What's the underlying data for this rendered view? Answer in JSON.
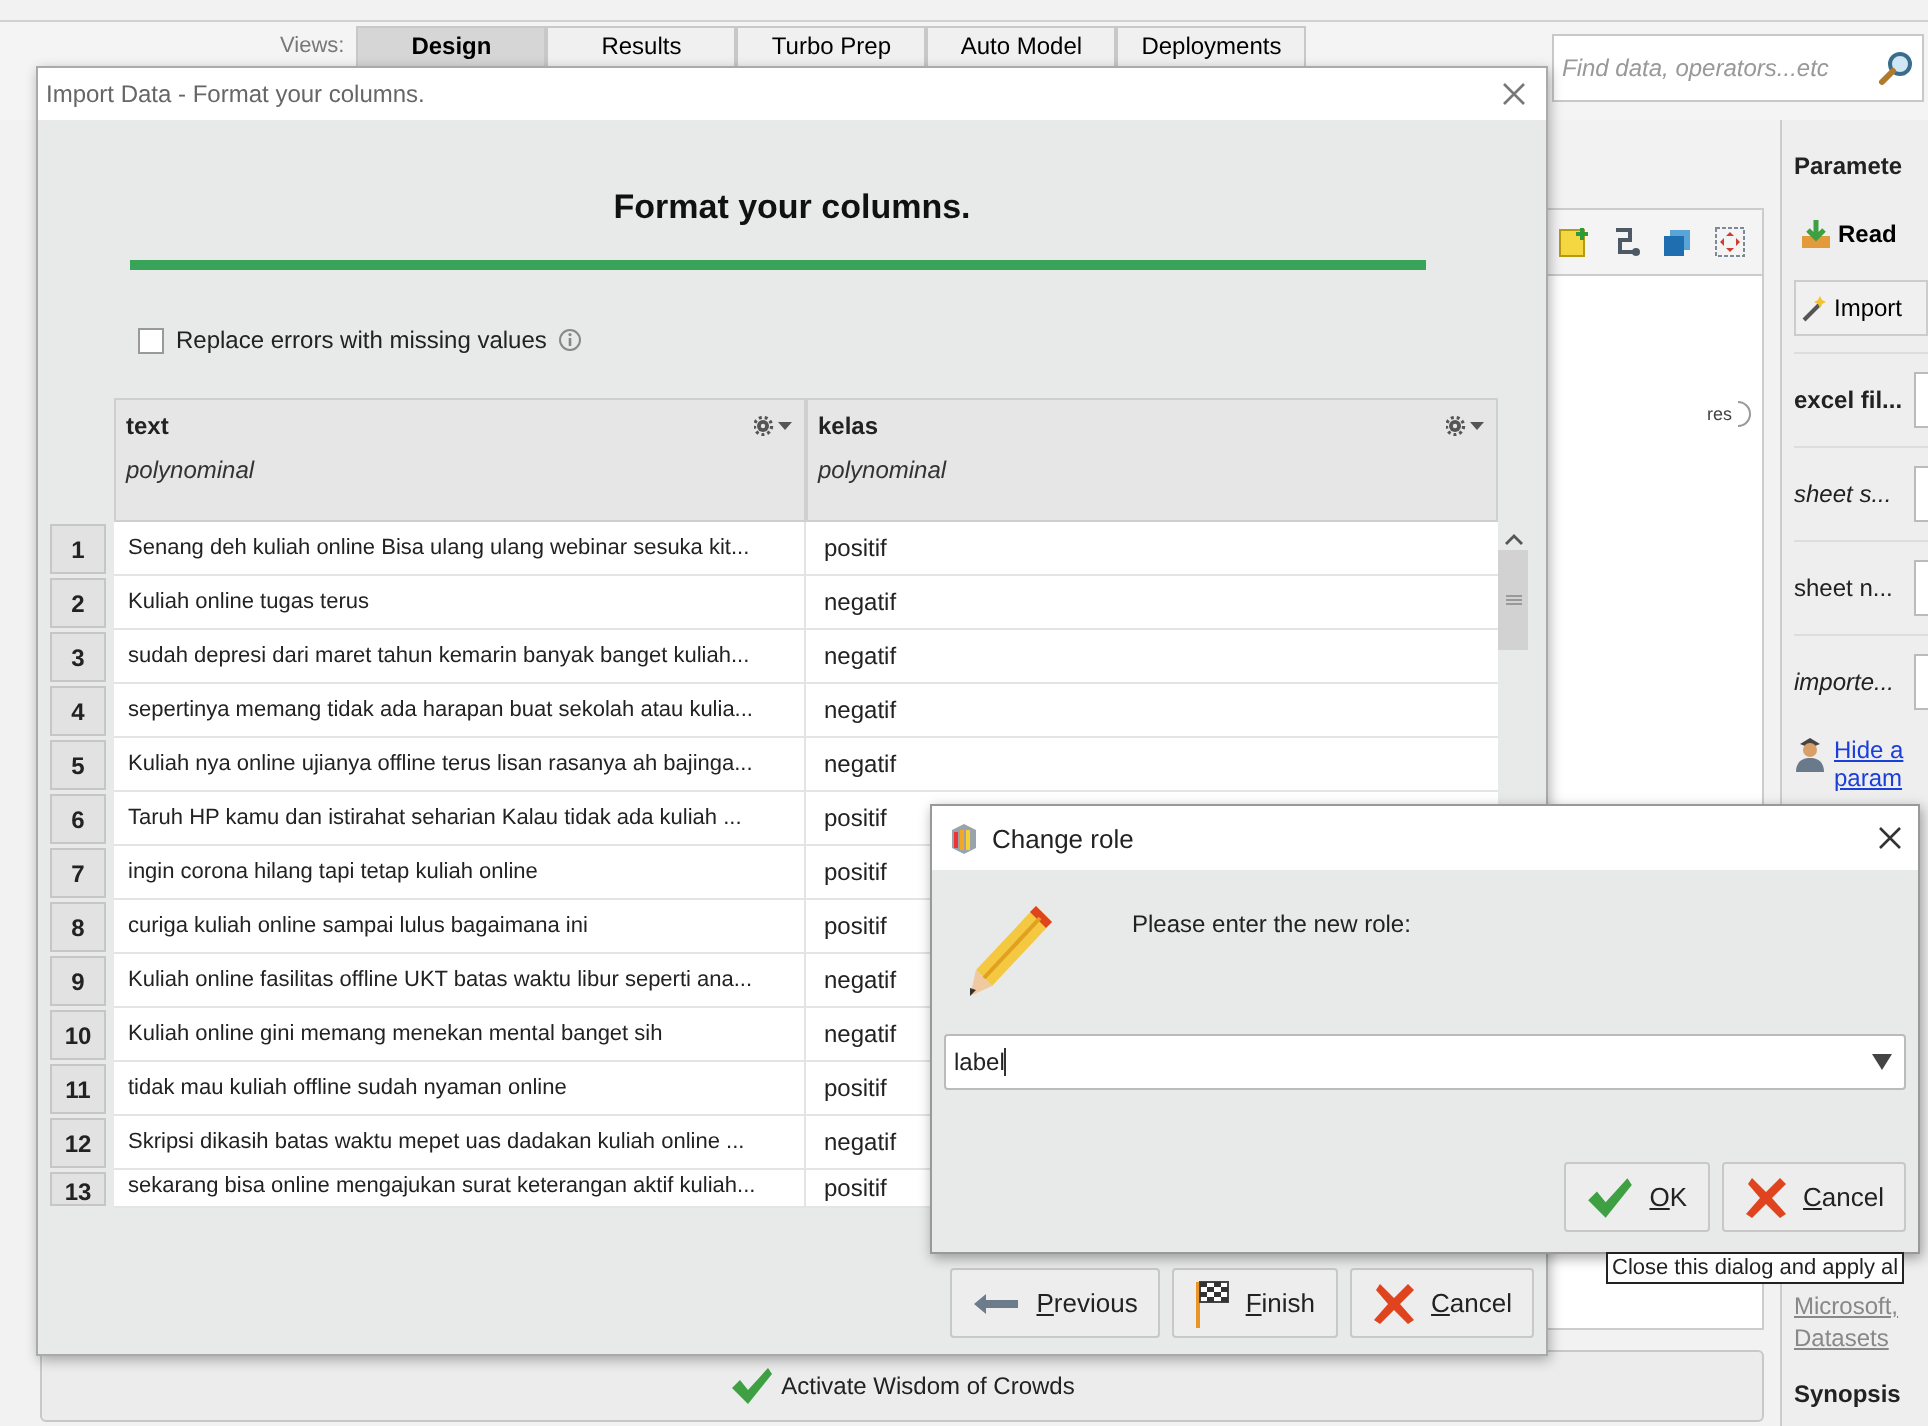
{
  "app": {
    "views_label": "Views:",
    "view_tabs": [
      {
        "label": "Design",
        "selected": true
      },
      {
        "label": "Results",
        "selected": false
      },
      {
        "label": "Turbo Prep",
        "selected": false
      },
      {
        "label": "Auto Model",
        "selected": false
      },
      {
        "label": "Deployments",
        "selected": false
      }
    ],
    "search": {
      "placeholder": "Find data, operators...etc"
    }
  },
  "canvas": {
    "port_label": "res"
  },
  "parameters": {
    "title": "Paramete",
    "buttons": [
      "Read",
      "Import"
    ],
    "fields": [
      {
        "label": "excel fil...",
        "kind": "bold"
      },
      {
        "label": "sheet s...",
        "kind": "italic"
      },
      {
        "label": "sheet n...",
        "kind": "plain"
      },
      {
        "label": "importe...",
        "kind": "italic"
      }
    ],
    "expert_link": [
      "Hide a",
      "param"
    ],
    "doc_links": [
      "Microsoft,",
      "Datasets"
    ],
    "section": "Synopsis"
  },
  "wisdom_bar": {
    "label": "Activate Wisdom of Crowds"
  },
  "import_dialog": {
    "title": "Import Data - Format your columns.",
    "heading": "Format your columns.",
    "checkbox": {
      "label": "Replace errors with missing values",
      "checked": false
    },
    "columns": [
      {
        "name": "text",
        "type": "polynominal"
      },
      {
        "name": "kelas",
        "type": "polynominal"
      }
    ],
    "rows": [
      {
        "number": "1",
        "text": "Senang deh kuliah online Bisa ulang ulang webinar sesuka kit...",
        "kelas": "positif"
      },
      {
        "number": "2",
        "text": "Kuliah online tugas terus",
        "kelas": "negatif"
      },
      {
        "number": "3",
        "text": "sudah depresi dari maret tahun kemarin banyak banget kuliah...",
        "kelas": "negatif"
      },
      {
        "number": "4",
        "text": "sepertinya memang tidak ada harapan buat sekolah atau kulia...",
        "kelas": "negatif"
      },
      {
        "number": "5",
        "text": "Kuliah nya online ujianya offline terus lisan rasanya ah bajinga...",
        "kelas": "negatif"
      },
      {
        "number": "6",
        "text": "Taruh HP kamu dan istirahat seharian Kalau tidak ada kuliah ...",
        "kelas": "positif"
      },
      {
        "number": "7",
        "text": "ingin corona hilang tapi tetap kuliah online",
        "kelas": "positif"
      },
      {
        "number": "8",
        "text": "curiga kuliah online sampai lulus bagaimana ini",
        "kelas": "positif"
      },
      {
        "number": "9",
        "text": "Kuliah online fasilitas offline UKT batas waktu libur seperti ana...",
        "kelas": "negatif"
      },
      {
        "number": "10",
        "text": "Kuliah online gini memang menekan mental banget sih",
        "kelas": "negatif"
      },
      {
        "number": "11",
        "text": "tidak mau kuliah offline sudah nyaman online",
        "kelas": "positif"
      },
      {
        "number": "12",
        "text": "Skripsi dikasih batas waktu mepet uas dadakan kuliah online ...",
        "kelas": "negatif"
      },
      {
        "number": "13",
        "text": "sekarang bisa online mengajukan surat keterangan aktif kuliah...",
        "kelas": "positif"
      }
    ],
    "buttons": [
      {
        "label": "Previous",
        "kind": "previous"
      },
      {
        "label": "Finish",
        "kind": "finish"
      },
      {
        "label": "Cancel",
        "kind": "cancel"
      }
    ]
  },
  "role_dialog": {
    "title": "Change role",
    "prompt": "Please enter the new role:",
    "value": "label",
    "buttons": [
      {
        "label": "OK",
        "kind": "ok"
      },
      {
        "label": "Cancel",
        "kind": "cancel"
      }
    ]
  },
  "tooltip": "Close this dialog and apply al"
}
